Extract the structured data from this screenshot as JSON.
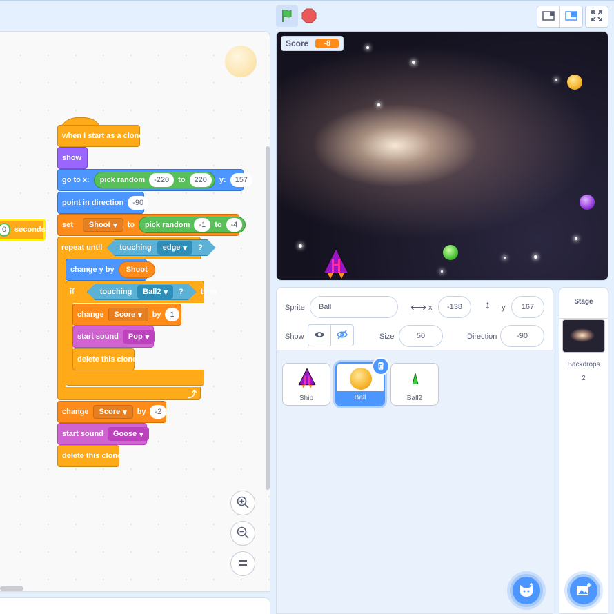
{
  "stage": {
    "score_monitor": {
      "label": "Score",
      "value": "-8"
    }
  },
  "script": {
    "partial_block_suffix": "seconds",
    "partial_block_value": "0",
    "hat": "when I start as a clone",
    "show": "show",
    "goto": {
      "label": "go to x:",
      "op": "pick random",
      "from": "-220",
      "to_label": "to",
      "to": "220",
      "y_label": "y:",
      "y": "157"
    },
    "point": {
      "label": "point in direction",
      "value": "-90"
    },
    "set": {
      "label": "set",
      "var": "Shoot",
      "to_label": "to",
      "op": "pick random",
      "from": "-1",
      "to_label2": "to",
      "to": "-4"
    },
    "repeat": {
      "label": "repeat until",
      "sense": "touching",
      "target": "edge",
      "q": "?"
    },
    "change_y": {
      "label": "change y by",
      "value": "Shoot"
    },
    "if": {
      "label": "if",
      "sense": "touching",
      "target": "Ball2",
      "q": "?",
      "then": "then"
    },
    "change_score_1": {
      "label": "change",
      "var": "Score",
      "by": "by",
      "value": "1"
    },
    "sound_pop": {
      "label": "start sound",
      "sound": "Pop"
    },
    "delete_inner": "delete this clone",
    "change_score_2": {
      "label": "change",
      "var": "Score",
      "by": "by",
      "value": "-2"
    },
    "sound_goose": {
      "label": "start sound",
      "sound": "Goose"
    },
    "delete_outer": "delete this clone"
  },
  "sprite_info": {
    "sprite_label": "Sprite",
    "sprite_name": "Ball",
    "x_label": "x",
    "x": "-138",
    "y_label": "y",
    "y": "167",
    "show_label": "Show",
    "size_label": "Size",
    "size": "50",
    "direction_label": "Direction",
    "direction": "-90"
  },
  "sprites": [
    {
      "name": "Ship"
    },
    {
      "name": "Ball"
    },
    {
      "name": "Ball2"
    }
  ],
  "stage_pane": {
    "title": "Stage",
    "backdrops_label": "Backdrops",
    "backdrops_count": "2"
  },
  "colors": {
    "motion": "#4c97ff",
    "looks": "#9966ff",
    "sound": "#cf63cf",
    "events": "#ffab19",
    "control": "#ffab19",
    "sensing": "#5cb1d6",
    "operators": "#59c059",
    "variables": "#ff8c1a"
  },
  "icons": [
    "green-flag-icon",
    "stop-icon",
    "small-stage-icon",
    "normal-stage-icon",
    "fullscreen-icon",
    "zoom-in-icon",
    "zoom-out-icon",
    "zoom-reset-icon",
    "eye-icon",
    "eye-off-icon",
    "trash-icon",
    "choose-sprite-icon",
    "choose-backdrop-icon"
  ]
}
